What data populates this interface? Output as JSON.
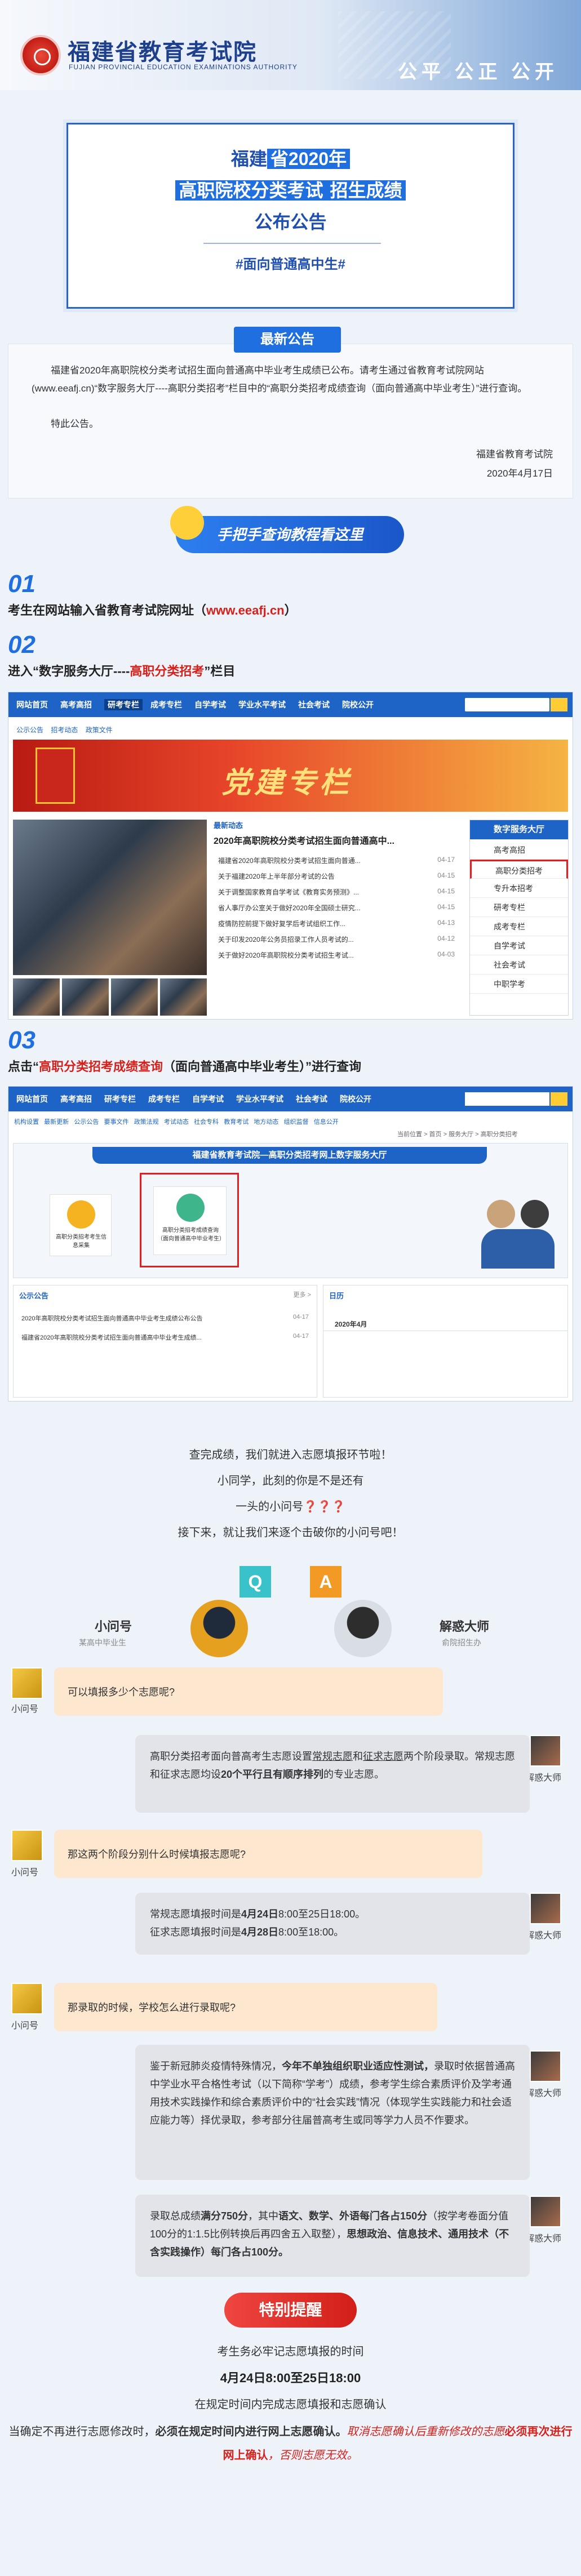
{
  "header": {
    "org_name": "福建省教育考试院",
    "org_name_en": "FUJIAN PROVINCIAL EDUCATION EXAMINATIONS AUTHORITY",
    "slogan": "公平 公正 公开"
  },
  "notice_card": {
    "line1_pre": "福建",
    "line1_hl": "省2020年",
    "line2_pre": "高职院校分类考试",
    "line2_hl": "招生成绩",
    "line3": "公布公告",
    "tag": "#面向普通高中生#"
  },
  "latest_notice": {
    "badge": "最新公告",
    "body": "福建省2020年高职院校分类考试招生面向普通高中毕业考生成绩已公布。请考生通过省教育考试院网站(www.eeafj.cn)“数字服务大厅----高职分类招考”栏目中的“高职分类招考成绩查询（面向普通高中毕业考生）”进行查询。",
    "body2": "特此公告。",
    "sign_org": "福建省教育考试院",
    "sign_date": "2020年4月17日"
  },
  "tutorial_button": "手把手查询教程看这里",
  "steps": [
    {
      "num": "01",
      "text_pre": "考生在网站输入省教育考试院网址（",
      "text_hl": "www.eeafj.cn",
      "text_post": "）"
    },
    {
      "num": "02",
      "text_pre": "进入“数字服务大厅----",
      "text_hl": "高职分类招考",
      "text_post": "”栏目"
    },
    {
      "num": "03",
      "text_pre": "点击“",
      "text_hl": "高职分类招考成绩查询",
      "text_post": "（面向普通高中毕业考生）”进行查询"
    }
  ],
  "site1": {
    "nav": [
      "网站首页",
      "高考高招",
      "研考专栏",
      "成考专栏",
      "自学考试",
      "学业水平考试",
      "社会考试",
      "院校公开"
    ],
    "subnav": [
      "公示公告",
      "招考动态",
      "政策文件"
    ],
    "banner": "党建专栏",
    "news_header": "最新动态",
    "news_title": "2020年高职院校分类考试招生面向普通高中...",
    "news": [
      {
        "t": "福建省2020年高职院校分类考试招生面向普通...",
        "d": "04-17"
      },
      {
        "t": "关于福建2020年上半年部分考试的公告",
        "d": "04-15"
      },
      {
        "t": "关于调整国家教育自学考试《教育实务预测》...",
        "d": "04-15"
      },
      {
        "t": "省人事厅办公室关于做好2020年全国硕士研究...",
        "d": "04-15"
      },
      {
        "t": "疫情防控前提下做好复学后考试组织工作...",
        "d": "04-13"
      },
      {
        "t": "关于印发2020年公务员招录工作人员考试的...",
        "d": "04-12"
      },
      {
        "t": "关于做好2020年高职院校分类考试招生考试...",
        "d": "04-03"
      }
    ],
    "sidebar_title": "数字服务大厅",
    "sidebar": [
      "高考高招",
      "高职分类招考",
      "专升本招考",
      "研考专栏",
      "成考专栏",
      "自学考试",
      "社会考试",
      "中职学考"
    ]
  },
  "site2": {
    "nav": [
      "网站首页",
      "高考高招",
      "研考专栏",
      "成考专栏",
      "自学考试",
      "学业水平考试",
      "社会考试",
      "院校公开"
    ],
    "subnav": [
      "机构设置",
      "最新更新",
      "公示公告",
      "要事文件",
      "政策法规",
      "考试动态",
      "社会专科",
      "教育考试",
      "地方动态",
      "组织监督",
      "信息公开"
    ],
    "breadcrumb": "当前位置 > 首页 > 服务大厅 > 高职分类招考",
    "hall_title": "福建省教育考试院—高职分类招考网上数字服务大厅",
    "tile1": "高职分类招考考生信息采集",
    "tile2": "高职分类招考成绩查询（面向普通高中毕业考生）",
    "notice_header": "公示公告",
    "notice_more": "更多 >",
    "notices": [
      {
        "t": "2020年高职院校分类考试招生面向普通高中毕业考生成绩公布公告",
        "d": "04-17"
      },
      {
        "t": "福建省2020年高职院校分类考试招生面向普通高中毕业考生成绩...",
        "d": "04-17"
      }
    ],
    "calendar_header": "日历",
    "calendar_month": "2020年4月"
  },
  "intro": [
    "查完成绩，我们就进入志愿填报环节啦！",
    "小同学，此刻的你是不是还有",
    "一头的小问号❓❓❓",
    "接下来，就让我们来逐个击破你的小问号吧！"
  ],
  "qa_header": {
    "q": "Q",
    "a": "A",
    "q_name": "小问号",
    "q_desc": "某高中毕业生",
    "a_name": "解惑大师",
    "a_desc": "俞院招生办"
  },
  "chat": [
    {
      "q": "可以填报多少个志愿呢?",
      "a_pre": "高职分类招考面向普高考生志愿设置",
      "a_b1": "常规志愿",
      "a_mid1": "和",
      "a_b2": "征求志愿",
      "a_mid2": "两个阶段录取。常规志愿和征求志愿均设",
      "a_b3": "20个平行且有顺序排列",
      "a_post": "的专业志愿。"
    },
    {
      "q": "那这两个阶段分别什么时候填报志愿呢?",
      "a_line1_pre": "常规志愿填报时间是",
      "a_line1_b": "4月24日",
      "a_line1_post": "8:00至25日18:00。",
      "a_line2_pre": "征求志愿填报时间是",
      "a_line2_b": "4月28日",
      "a_line2_post": "8:00至18:00。"
    },
    {
      "q": "那录取的时候，学校怎么进行录取呢?",
      "a1_pre": "鉴于新冠肺炎疫情特殊情况，",
      "a1_b": "今年不单独组织职业适应性测试，",
      "a1_post": "录取时依据普通高中学业水平合格性考试（以下简称“学考”）成绩，参考学生综合素质评价及学考通用技术实践操作和综合素质评价中的“社会实践”情况（体现学生实践能力和社会适应能力等）择优录取，参考部分往届普高考生或同等学力人员不作要求。",
      "a2_pre": "录取总成绩",
      "a2_b1": "满分750分",
      "a2_mid1": "，其中",
      "a2_b2": "语文、数学、外语每门各占150分",
      "a2_mid2": "（按学考卷面分值100分的1:1.5比例转换后再四舍五入取整），",
      "a2_b3": "思想政治、信息技术、通用技术（不含实践操作）每门各占100分。"
    }
  ],
  "tip": {
    "badge": "特别提醒",
    "line1": "考生务必牢记志愿填报的时间",
    "line2": "4月24日8:00至25日18:00",
    "line3": "在规定时间内完成志愿填报和志愿确认",
    "line4_pre": "当确定不再进行志愿修改时，",
    "line4_b": "必须在规定时间内进行网上志愿确认。",
    "line4_red": "取消志愿确认后重新修改的志愿",
    "line4_redb": "必须再次进行网上确认",
    "line4_red2": "，否则志愿无效。"
  }
}
